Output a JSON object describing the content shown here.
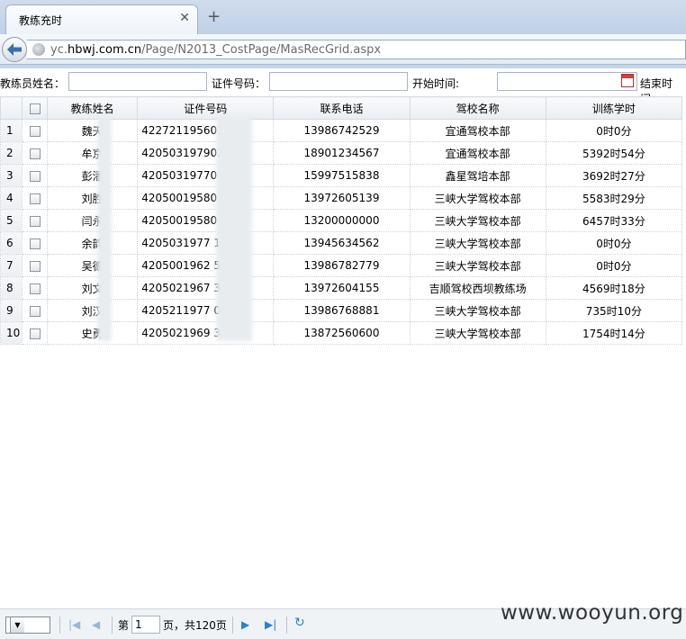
{
  "browser": {
    "tab_title": "教练充时",
    "tab_close": "✕",
    "new_tab": "+",
    "url_prefix": "yc.",
    "url_domain": "hbwj.com.cn",
    "url_path": "/Page/N2013_CostPage/MasRecGrid.aspx"
  },
  "search": {
    "coach_name_label": "教练员姓名：",
    "id_label": "证件号码：",
    "start_label": "开始时间:",
    "end_label": "结束时间:"
  },
  "grid": {
    "columns": [
      "",
      "教练姓名",
      "证件号码",
      "联系电话",
      "驾校名称",
      "训练学时"
    ],
    "rows": [
      {
        "num": "1",
        "name": "魏天",
        "id": "422721195601    3KS",
        "phone": "13986742529",
        "school": "宜通驾校本部",
        "hours": "0时0分"
      },
      {
        "num": "2",
        "name": "牟京",
        "id": "420503197902     4",
        "phone": "18901234567",
        "school": "宜通驾校本部",
        "hours": "5392时54分"
      },
      {
        "num": "3",
        "name": "彭潘",
        "id": "42050319770     3",
        "phone": "15997515838",
        "school": "鑫星驾培本部",
        "hours": "3692时27分"
      },
      {
        "num": "4",
        "name": "刘胜",
        "id": "42050019580     7",
        "phone": "13972605139",
        "school": "三峡大学驾校本部",
        "hours": "5583时29分"
      },
      {
        "num": "5",
        "name": "闫永",
        "id": "42050019580    15",
        "phone": "13200000000",
        "school": "三峡大学驾校本部",
        "hours": "6457时33分"
      },
      {
        "num": "6",
        "name": "余韵",
        "id": "4205031977     15",
        "phone": "13945634562",
        "school": "三峡大学驾校本部",
        "hours": "0时0分"
      },
      {
        "num": "7",
        "name": "吴德",
        "id": "4205001962     58",
        "phone": "13986782779",
        "school": "三峡大学驾校本部",
        "hours": "0时0分"
      },
      {
        "num": "8",
        "name": "刘文",
        "id": "4205021967     31",
        "phone": "13972604155",
        "school": "吉顺驾校西坝教练场",
        "hours": "4569时18分"
      },
      {
        "num": "9",
        "name": "刘汉",
        "id": "4205211977     099",
        "phone": "13986768881",
        "school": "三峡大学驾校本部",
        "hours": "735时10分"
      },
      {
        "num": "10",
        "name": "史勇",
        "id": "4205021969     31",
        "phone": "13872560600",
        "school": "三峡大学驾校本部",
        "hours": "1754时14分"
      }
    ]
  },
  "pager": {
    "page_size": "10",
    "page_prefix": "第",
    "current_page": "1",
    "page_suffix": "页，共120页"
  },
  "watermark": "www.wooyun.org",
  "colors": {
    "accent": "#2d7fd0",
    "header_bg": "#e9eef4"
  },
  "icons": [
    "back-arrow-icon",
    "globe-icon",
    "calendar-icon",
    "first-page-icon",
    "prev-page-icon",
    "next-page-icon",
    "last-page-icon",
    "refresh-icon",
    "checkbox-icon"
  ]
}
